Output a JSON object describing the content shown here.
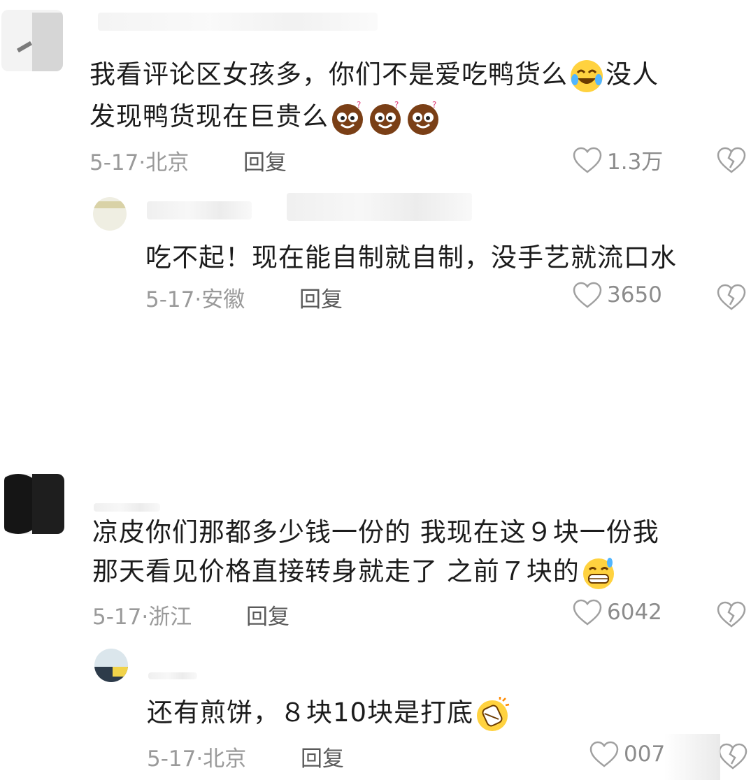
{
  "comments": [
    {
      "text_line1": "我看评论区女孩多，你们不是爱吃鸭货么",
      "text_after_emoji": "没人",
      "text_line2": "发现鸭货现在巨贵么",
      "date": "5-17",
      "location": "北京",
      "reply_label": "回复",
      "likes": "1.3万",
      "emoji_line1": "laughing-crying-emoji",
      "emoji_line2": "confused-face-emoji"
    },
    {
      "text_line1": "吃不起！现在能自制就自制，没手艺就流口水",
      "date": "5-17",
      "location": "安徽",
      "reply_label": "回复",
      "likes": "3650"
    },
    {
      "text_line1": "凉皮你们那都多少钱一份的  我现在这９块一份我",
      "text_line2": "那天看见价格直接转身就走了 之前７块的",
      "date": "5-17",
      "location": "浙江",
      "reply_label": "回复",
      "likes": "6042",
      "emoji_line2": "grinning-sweat-emoji"
    },
    {
      "text_line1": "还有煎饼，８块10块是打底",
      "date": "5-17",
      "location": "北京",
      "reply_label": "回复",
      "likes": "007",
      "emoji_line1": "shocked-emoji"
    }
  ],
  "icons": {
    "like": "heart-outline-icon",
    "dislike": "broken-heart-icon"
  },
  "colors": {
    "meta_text": "#9a9a9a",
    "body_text": "#1c1c1c",
    "icon": "#a0a0a0"
  }
}
